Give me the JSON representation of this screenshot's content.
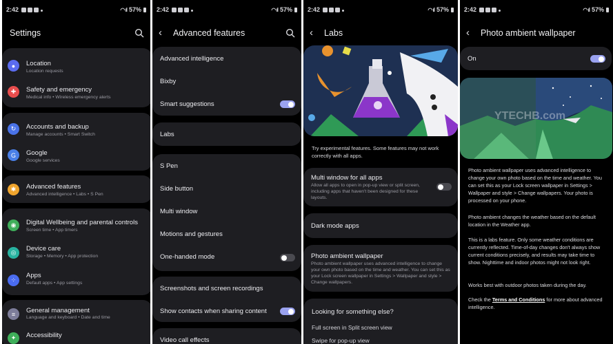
{
  "status_bar": {
    "time": "2:42",
    "battery": "57%"
  },
  "panel1": {
    "title": "Settings",
    "items": [
      {
        "label": "Location",
        "sub": "Location requests",
        "icon": "location-icon",
        "color": "#5b6cf0"
      },
      {
        "label": "Safety and emergency",
        "sub": "Medical info  •  Wireless emergency alerts",
        "icon": "safety-icon",
        "color": "#e84d4d"
      },
      {
        "label": "Accounts and backup",
        "sub": "Manage accounts  •  Smart Switch",
        "icon": "sync-icon",
        "color": "#4a73e8"
      },
      {
        "label": "Google",
        "sub": "Google services",
        "icon": "google-icon",
        "color": "#4a80e8"
      },
      {
        "label": "Advanced features",
        "sub": "Advanced intelligence  •  Labs  •  S Pen",
        "icon": "star-gear-icon",
        "color": "#f0a52e"
      },
      {
        "label": "Digital Wellbeing and parental controls",
        "sub": "Screen time  •  App timers",
        "icon": "wellbeing-icon",
        "color": "#3fae5a"
      },
      {
        "label": "Device care",
        "sub": "Storage  •  Memory  •  App protection",
        "icon": "device-care-icon",
        "color": "#28b2a0"
      },
      {
        "label": "Apps",
        "sub": "Default apps  •  App settings",
        "icon": "apps-icon",
        "color": "#4a6cf0"
      },
      {
        "label": "General management",
        "sub": "Language and keyboard  •  Date and time",
        "icon": "sliders-icon",
        "color": "#7d7d9a"
      },
      {
        "label": "Accessibility",
        "sub": "",
        "icon": "accessibility-icon",
        "color": "#3fae5a"
      }
    ]
  },
  "panel2": {
    "title": "Advanced features",
    "items": [
      {
        "label": "Advanced intelligence"
      },
      {
        "label": "Bixby"
      },
      {
        "label": "Smart suggestions",
        "toggle": "on"
      },
      {
        "label": "Labs"
      },
      {
        "label": "S Pen"
      },
      {
        "label": "Side button"
      },
      {
        "label": "Multi window"
      },
      {
        "label": "Motions and gestures"
      },
      {
        "label": "One-handed mode",
        "toggle": "off"
      },
      {
        "label": "Screenshots and screen recordings"
      },
      {
        "label": "Show contacts when sharing content",
        "toggle": "on"
      },
      {
        "label": "Video call effects"
      }
    ]
  },
  "panel3": {
    "title": "Labs",
    "intro": "Try experimental features. Some features may not work correctly with all apps.",
    "items": [
      {
        "label": "Multi window for all apps",
        "sub": "Allow all apps to open in pop-up view or split screen, including apps that haven't been designed for these layouts.",
        "toggle": "off"
      },
      {
        "label": "Dark mode apps"
      },
      {
        "label": "Photo ambient wallpaper",
        "sub": "Photo ambient wallpaper uses advanced intelligence to change your own photo based on the time and weather. You can set this as your Lock screen wallpaper in Settings > Wallpaper and style > Change wallpapers."
      }
    ],
    "looking": {
      "title": "Looking for something else?",
      "links": [
        "Full screen in Split screen view",
        "Swipe for pop-up view"
      ]
    }
  },
  "panel4": {
    "title": "Photo ambient wallpaper",
    "on_label": "On",
    "watermark": "YTECHB.com",
    "paragraphs": [
      "Photo ambient wallpaper uses advanced intelligence to change your own photo based on the time and weather. You can set this as your Lock screen wallpaper in Settings > Wallpaper and style > Change wallpapers. Your photo is processed on your phone.",
      "Photo ambient changes the weather based on the default location in the Weather app.",
      "This is a labs feature. Only some weather conditions are currently reflected. Time-of-day changes don't always show current conditions precisely, and results may take time to show. Nighttime and indoor photos might not look right.",
      "Works best with outdoor photos taken during the day."
    ],
    "terms_prefix": "Check the ",
    "terms_link": "Terms and Conditions",
    "terms_suffix": " for more about advanced intelligence."
  }
}
